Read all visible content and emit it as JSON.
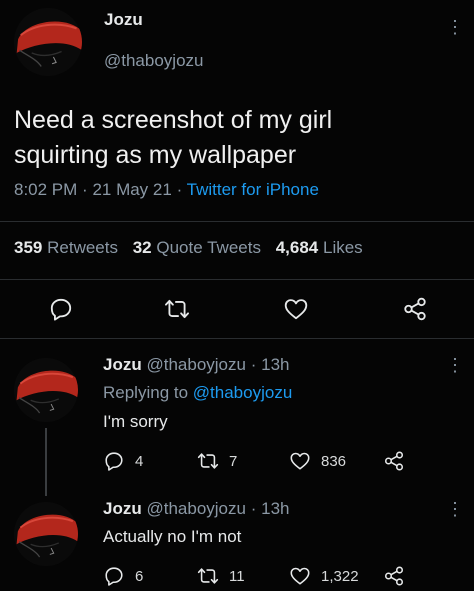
{
  "main_tweet": {
    "name": "Jozu",
    "handle": "@thaboyjozu",
    "text_line1": "Need a screenshot of my girl",
    "text_line2": "squirting as my wallpaper",
    "time": "8:02 PM",
    "date": "21 May 21",
    "source": "Twitter for iPhone",
    "retweets_count": "359",
    "retweets_label": "Retweets",
    "quotes_count": "32",
    "quotes_label": "Quote Tweets",
    "likes_count": "4,684",
    "likes_label": "Likes",
    "action_icons": [
      "reply-icon",
      "retweet-icon",
      "like-icon",
      "share-icon"
    ]
  },
  "replies": [
    {
      "name": "Jozu",
      "handle": "@thaboyjozu",
      "age": "13h",
      "replying_prefix": "Replying to",
      "replying_handle": "@thaboyjozu",
      "text": "I'm sorry",
      "reply_count": "4",
      "retweet_count": "7",
      "like_count": "836"
    },
    {
      "name": "Jozu",
      "handle": "@thaboyjozu",
      "age": "13h",
      "text": "Actually no I'm not",
      "reply_count": "6",
      "retweet_count": "11",
      "like_count": "1,322"
    }
  ],
  "colors": {
    "background": "#050505",
    "text": "#e7e9ea",
    "muted": "#8b98a5",
    "link": "#1d9bf0",
    "avatar_red": "#b3271c"
  }
}
